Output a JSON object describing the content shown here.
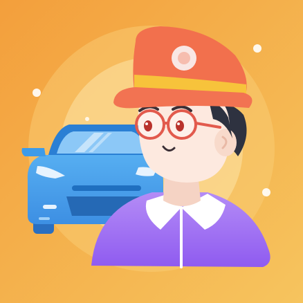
{
  "illustration": {
    "icons": {
      "scene": "driver-avatar-illustration",
      "car": "car-icon",
      "person": "chauffeur-icon",
      "hat": "cap-icon",
      "glasses": "glasses-icon"
    },
    "colors": {
      "bg_left": "#f39f3c",
      "bg_right": "#f6c45e",
      "halo_outer": "#fbd079",
      "halo_inner": "#fde3a6",
      "car_body": "#3d9be9",
      "car_dark": "#2a7fd4",
      "car_window": "#8cc8f7",
      "cap": "#f2704d",
      "cap_band": "#f7c33b",
      "badge": "#f9e7e4",
      "skin": "#fde9df",
      "hair": "#2e3240",
      "shirt_top": "#b48cf6",
      "shirt_bottom": "#8f5bf0",
      "collar": "#ffffff",
      "glasses": "#e25a4d"
    }
  }
}
